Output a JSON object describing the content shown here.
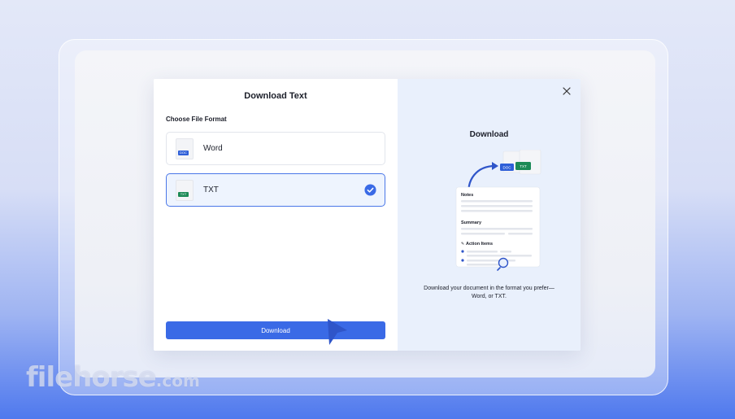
{
  "dialog": {
    "title": "Download Text",
    "section_label": "Choose File Format",
    "formats": [
      {
        "label": "Word",
        "icon_tag": "DOC",
        "selected": false
      },
      {
        "label": "TXT",
        "icon_tag": "TXT",
        "selected": true
      }
    ],
    "download_button_label": "Download"
  },
  "preview": {
    "title": "Download",
    "illustration": {
      "badge_doc": "DOC",
      "badge_txt": "TXT",
      "notes_heading": "Notes",
      "summary_heading": "Summary",
      "action_items_heading": "Action Items"
    },
    "caption_line1": "Download your document in the format you prefer—",
    "caption_line2": "Word, or TXT."
  },
  "watermark": {
    "brand": "filehorse",
    "domain": ".com"
  },
  "colors": {
    "accent": "#3a6ae6",
    "doc_tag": "#2e5fd8",
    "txt_tag": "#1c8a56",
    "selected_bg": "#eef4fe",
    "preview_bg": "#e9f0fc"
  }
}
